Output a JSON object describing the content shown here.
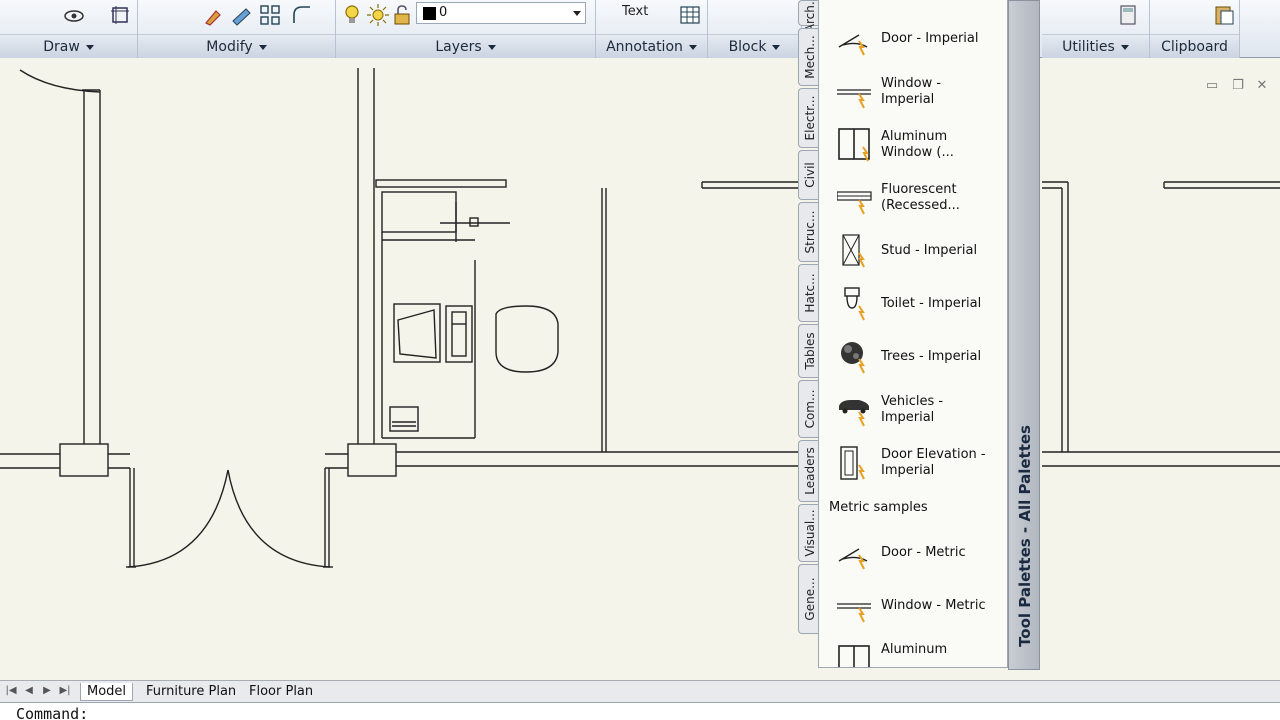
{
  "ribbon": {
    "panels": [
      {
        "label": "Draw"
      },
      {
        "label": "Modify"
      },
      {
        "label": "Layers"
      },
      {
        "label": "Annotation"
      },
      {
        "label": "Block"
      },
      {
        "label": "Utilities"
      },
      {
        "label": "Clipboard"
      }
    ],
    "annotation_text_label": "Text",
    "layer_value": "0"
  },
  "palette": {
    "title": "Tool Palettes - All Palettes",
    "tabs": [
      "Arch...",
      "Mech...",
      "Electr...",
      "Civil",
      "Struc...",
      "Hatc...",
      "Tables",
      "Com...",
      "Leaders",
      "Visual...",
      "Gene..."
    ],
    "items": [
      {
        "label": "Door - Imperial",
        "icon": "door-icon"
      },
      {
        "label": "Window - Imperial",
        "icon": "window-icon"
      },
      {
        "label": "Aluminum Window (...",
        "icon": "aluminum-window-icon"
      },
      {
        "label": "Fluorescent (Recessed...",
        "icon": "fluorescent-icon"
      },
      {
        "label": "Stud - Imperial",
        "icon": "stud-icon"
      },
      {
        "label": "Toilet - Imperial",
        "icon": "toilet-icon"
      },
      {
        "label": "Trees - Imperial",
        "icon": "trees-icon"
      },
      {
        "label": "Vehicles - Imperial",
        "icon": "vehicles-icon"
      },
      {
        "label": "Door Elevation - Imperial",
        "icon": "door-elevation-icon"
      }
    ],
    "group_label": "Metric samples",
    "metric_items": [
      {
        "label": "Door - Metric",
        "icon": "door-icon"
      },
      {
        "label": "Window - Metric",
        "icon": "window-icon"
      },
      {
        "label": "Aluminum",
        "icon": "aluminum-window-icon"
      }
    ]
  },
  "layout_tabs": [
    "Model",
    "Furniture Plan",
    "Floor Plan"
  ],
  "command_line": "Command:"
}
